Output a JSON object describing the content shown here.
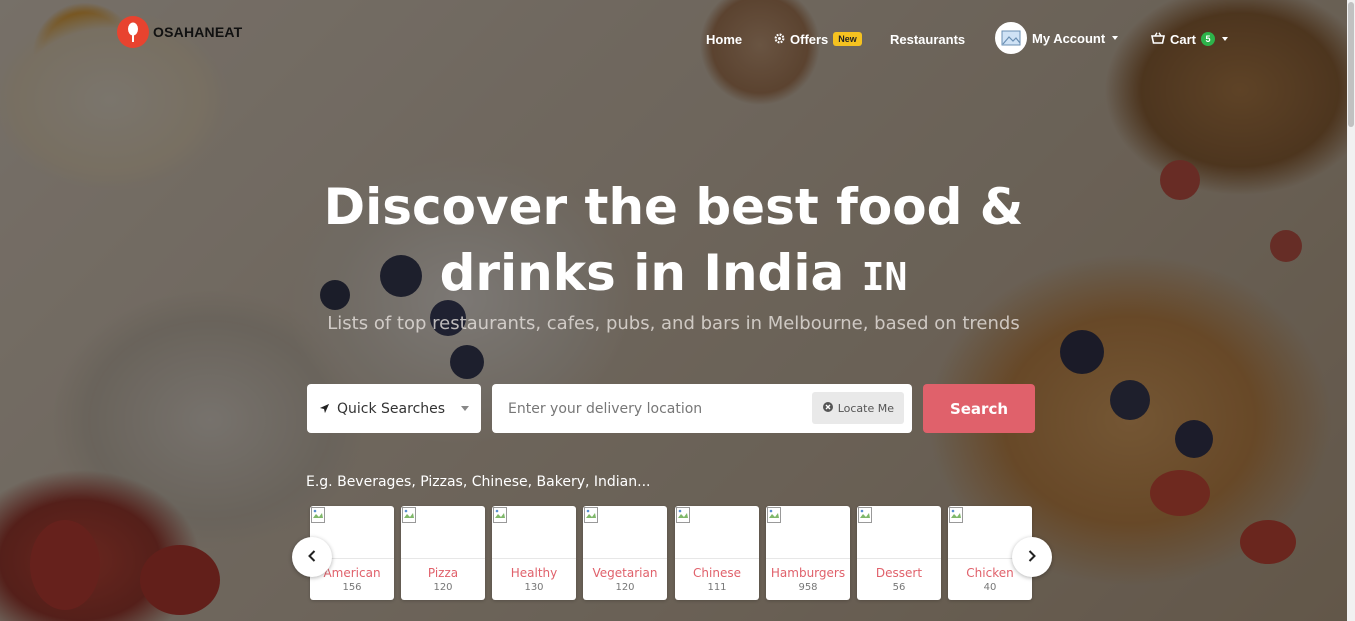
{
  "brand": {
    "name": "OSAHANEAT"
  },
  "nav": {
    "home": "Home",
    "offers": "Offers",
    "offers_badge": "New",
    "restaurants": "Restaurants",
    "account": "My Account",
    "cart": "Cart",
    "cart_count": "5"
  },
  "hero": {
    "title_line1": "Discover the best food &",
    "title_line2": "drinks in India",
    "title_flag": "IN",
    "subtitle": "Lists of top restaurants, cafes, pubs, and bars in Melbourne, based on trends"
  },
  "search": {
    "quick_label": "Quick Searches",
    "location_placeholder": "Enter your delivery location",
    "locate_label": "Locate Me",
    "button_label": "Search"
  },
  "examples_text": "E.g. Beverages, Pizzas, Chinese, Bakery, Indian...",
  "categories": [
    {
      "name": "American",
      "count": "156"
    },
    {
      "name": "Pizza",
      "count": "120"
    },
    {
      "name": "Healthy",
      "count": "130"
    },
    {
      "name": "Vegetarian",
      "count": "120"
    },
    {
      "name": "Chinese",
      "count": "111"
    },
    {
      "name": "Hamburgers",
      "count": "958"
    },
    {
      "name": "Dessert",
      "count": "56"
    },
    {
      "name": "Chicken",
      "count": "40"
    }
  ],
  "icons": {
    "offers": "gear-icon",
    "cart": "basket-icon",
    "quick": "location-arrow-icon",
    "locate": "crosshair-icon",
    "prev": "chevron-left-icon",
    "next": "chevron-right-icon"
  },
  "colors": {
    "accent": "#e0616b",
    "badge_new": "#f5c220",
    "badge_cart": "#2db34a",
    "logo": "#e8432f"
  }
}
